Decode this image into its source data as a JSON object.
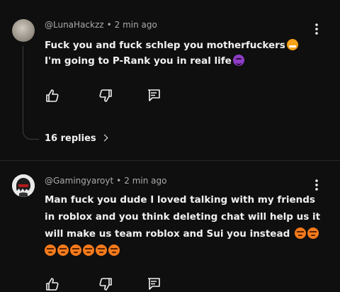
{
  "comments": [
    {
      "handle": "@LunaHackzz",
      "separator": "•",
      "time": "2 min ago",
      "lines": [
        "Fuck you and fuck schlep you motherfuckers",
        "I'm going to P-Rank you in real life"
      ],
      "emojis_line1": [
        "mouth-tape-emoji"
      ],
      "emojis_line2": [
        "smiling-devil-emoji"
      ],
      "replies_label": "16 replies"
    },
    {
      "handle": "@Gamingyaroyt",
      "separator": "•",
      "time": "2 min ago",
      "lines": [
        "Man fuck you dude I loved talking with my friends",
        "in roblox and you think deleting chat will help us it",
        "will make us team roblox and Sui you instead"
      ],
      "emojis_line3": [
        "angry-face-emoji",
        "angry-face-emoji"
      ],
      "emojis_line4": [
        "angry-face-emoji",
        "angry-face-emoji",
        "angry-face-emoji",
        "angry-face-emoji",
        "angry-face-emoji",
        "angry-face-emoji"
      ]
    }
  ],
  "colors": {
    "background": "#0f0f0f",
    "text": "#f1f1f1",
    "meta": "#aaaaaa",
    "thread": "#3f3f3f"
  }
}
